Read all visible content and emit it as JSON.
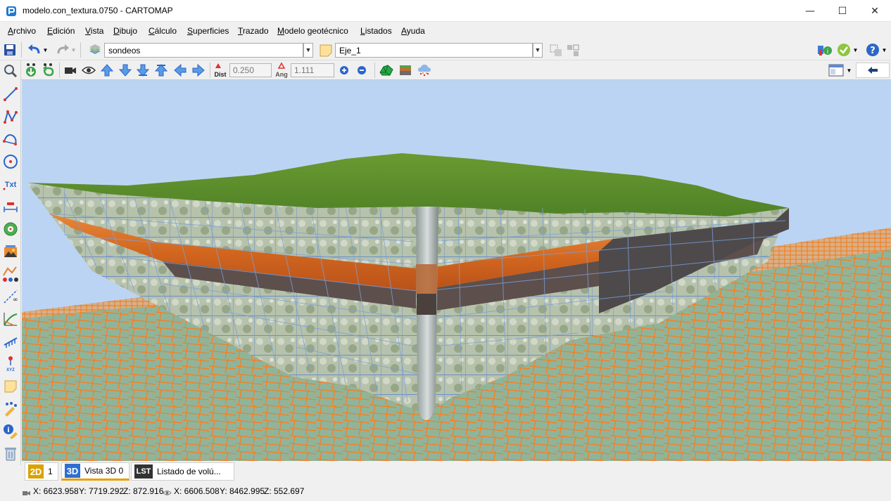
{
  "window": {
    "title": "modelo.con_textura.0750 - CARTOMAP",
    "minimize": "—",
    "maximize": "☐",
    "close": "✕"
  },
  "menu": [
    "Archivo",
    "Edición",
    "Vista",
    "Dibujo",
    "Cálculo",
    "Superficies",
    "Trazado",
    "Modelo geotécnico",
    "Listados",
    "Ayuda"
  ],
  "toolbar": {
    "layer_combo": "sondeos",
    "axis_combo": "Eje_1",
    "dist_label": "Dist",
    "dist_value": "0.250",
    "ang_label": "Ang",
    "ang_value": "1.111",
    "txt_tool": "Txt",
    "xyz_tool": "XYZ"
  },
  "tabs": [
    {
      "badge": "2D",
      "label": "1",
      "color": "#d9a300"
    },
    {
      "badge": "3D",
      "label": "Vista 3D 0",
      "color": "#2f6fd1"
    },
    {
      "badge": "LST",
      "label": "Listado de volú...",
      "color": "#333333"
    }
  ],
  "status": {
    "camera_x": "X: 6623.958",
    "camera_y": "Y: 7719.292",
    "camera_z": "Z: 872.916",
    "target_x": "X: 6606.508",
    "target_y": "Y: 8462.995",
    "target_z": "Z: 552.697"
  }
}
